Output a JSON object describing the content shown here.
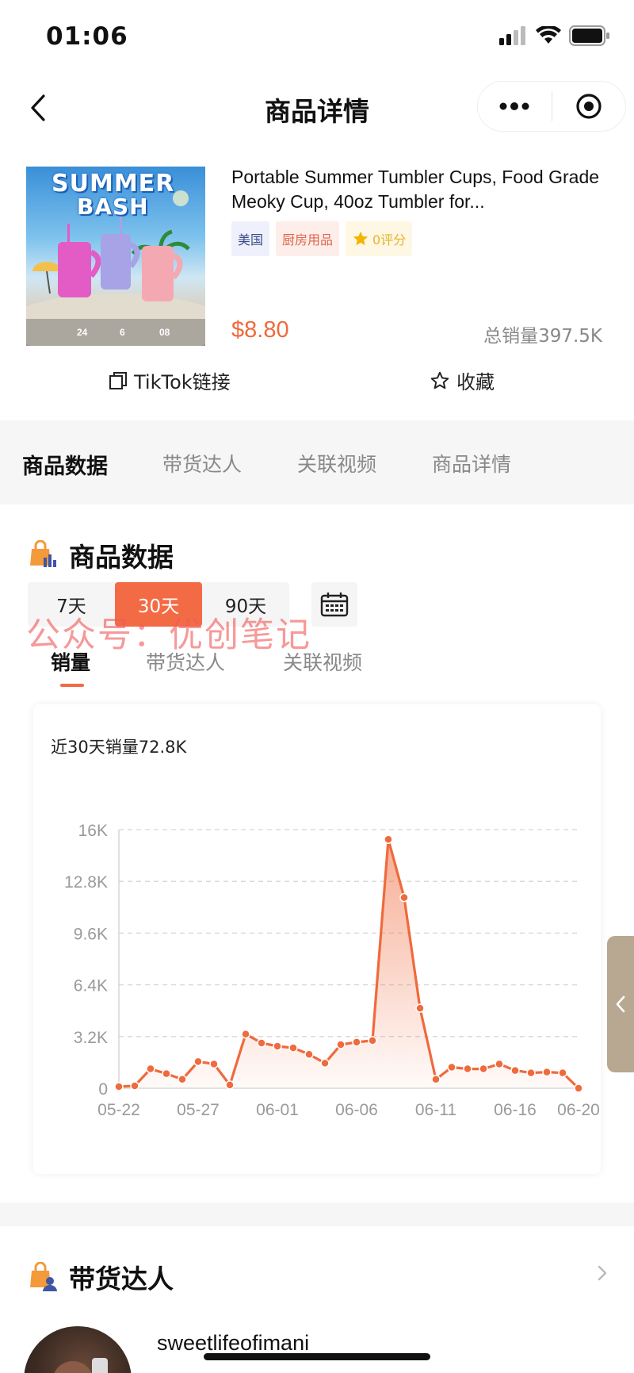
{
  "status_bar": {
    "time": "01:06"
  },
  "nav": {
    "title": "商品详情"
  },
  "product": {
    "title": "Portable Summer Tumbler Cups, Food Grade Meoky Cup, 40oz Tumbler for...",
    "tags": {
      "country": "美国",
      "category": "厨房用品",
      "rating": "0评分"
    },
    "image_text": {
      "line1": "SUMMER",
      "line2": "BASH",
      "hours": [
        "24",
        "6",
        "08"
      ]
    },
    "price": "$8.80",
    "total_sales": "总销量397.5K",
    "tiktok_link": "TikTok链接",
    "favorite": "收藏"
  },
  "main_tabs": [
    "商品数据",
    "带货达人",
    "关联视频",
    "商品详情"
  ],
  "product_data": {
    "title": "商品数据",
    "ranges": [
      "7天",
      "30天",
      "90天"
    ],
    "active_range": "30天",
    "watermark": "公众号：优创笔记",
    "sub_tabs": [
      "销量",
      "带货达人",
      "关联视频"
    ],
    "summary": "近30天销量72.8K"
  },
  "chart_data": {
    "type": "area",
    "x": [
      "05-22",
      "05-23",
      "05-24",
      "05-25",
      "05-26",
      "05-27",
      "05-28",
      "05-29",
      "05-30",
      "05-31",
      "06-01",
      "06-02",
      "06-03",
      "06-04",
      "06-05",
      "06-06",
      "06-07",
      "06-08",
      "06-09",
      "06-10",
      "06-11",
      "06-12",
      "06-13",
      "06-14",
      "06-15",
      "06-16",
      "06-17",
      "06-18",
      "06-19",
      "06-20"
    ],
    "x_tick_labels": [
      "05-22",
      "05-27",
      "06-01",
      "06-06",
      "06-11",
      "06-16",
      "06-20"
    ],
    "y_tick_labels": [
      "0",
      "3.2K",
      "6.4K",
      "9.6K",
      "12.8K",
      "16K"
    ],
    "ylim": [
      0,
      16000
    ],
    "grid": true,
    "values": [
      100,
      150,
      1200,
      900,
      550,
      1650,
      1500,
      200,
      3350,
      2800,
      2600,
      2500,
      2100,
      1550,
      2700,
      2850,
      2950,
      15400,
      11800,
      4950,
      550,
      1300,
      1200,
      1200,
      1500,
      1100,
      950,
      1000,
      950,
      0
    ],
    "color": "#ef6a3c"
  },
  "influencers": {
    "title": "带货达人",
    "first_name": "sweetlifeofimani"
  }
}
